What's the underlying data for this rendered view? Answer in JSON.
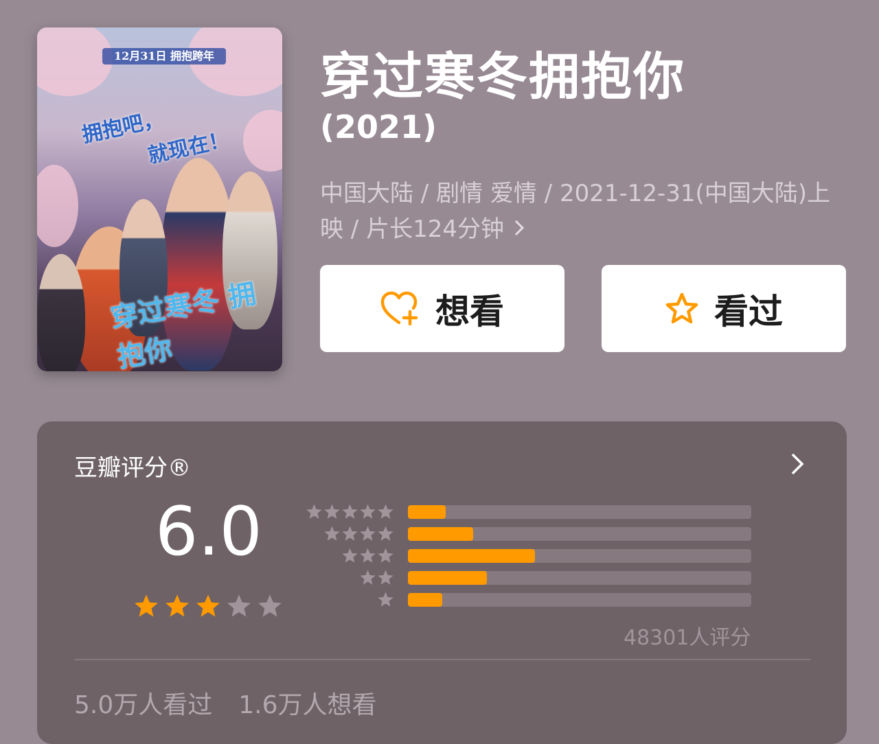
{
  "poster": {
    "tagline": "12月31日 拥抱跨年",
    "slogan_line1": "拥抱吧，",
    "slogan_line2": "就现在！",
    "title_art": "穿过寒冬 拥抱你"
  },
  "movie": {
    "title": "穿过寒冬拥抱你",
    "year": "(2021)",
    "meta": "中国大陆 / 剧情 爱情 / 2021-12-31(中国大陆)上映 / 片长124分钟",
    "meta_chevron_icon": "chevron-right-icon"
  },
  "actions": {
    "want_label": "想看",
    "want_icon": "heart-plus-icon",
    "seen_label": "看过",
    "seen_icon": "star-outline-icon",
    "accent_color": "#ff9a00"
  },
  "rating": {
    "title": "豆瓣评分®",
    "score": "6.0",
    "score_stars": 3,
    "max_stars": 5,
    "distribution": [
      {
        "stars": 5,
        "fraction": 0.11
      },
      {
        "stars": 4,
        "fraction": 0.19
      },
      {
        "stars": 3,
        "fraction": 0.37
      },
      {
        "stars": 2,
        "fraction": 0.23
      },
      {
        "stars": 1,
        "fraction": 0.1
      }
    ],
    "raters": "48301人评分",
    "seen_count": "5.0万人看过",
    "want_count": "1.6万人想看",
    "bar_color": "#ff9a00",
    "track_color": "#867a80"
  }
}
